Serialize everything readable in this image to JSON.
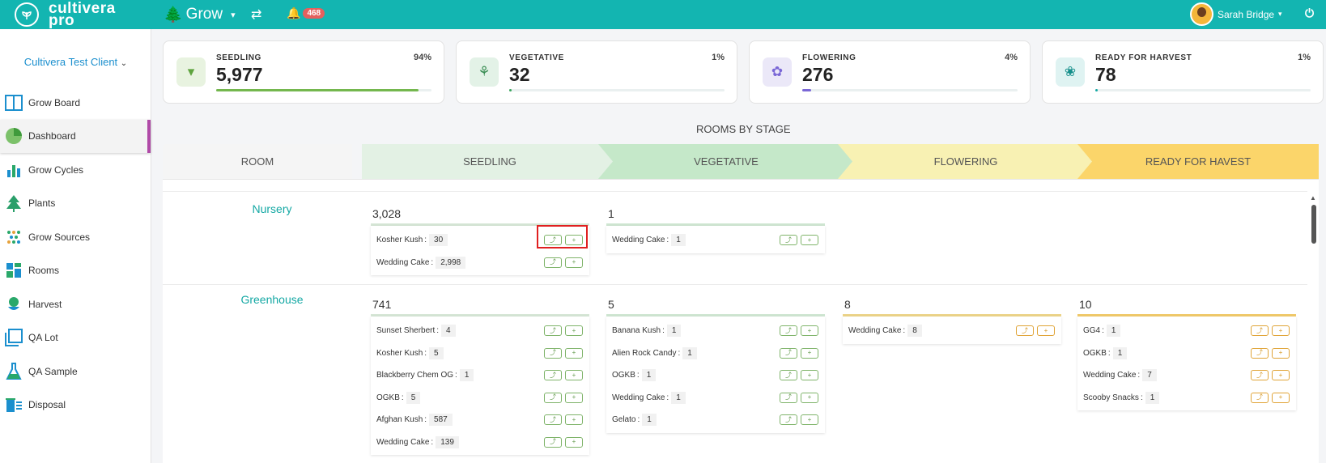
{
  "header": {
    "logo_text_1": "cultivera",
    "logo_text_2": "pro",
    "nav_grow": "Grow",
    "notifications": "468",
    "user_name": "Sarah Bridge"
  },
  "sidebar": {
    "client": "Cultivera Test Client",
    "items": [
      {
        "label": "Grow Board",
        "icon": "board-icon"
      },
      {
        "label": "Dashboard",
        "icon": "pie-chart-icon"
      },
      {
        "label": "Grow Cycles",
        "icon": "bar-chart-icon"
      },
      {
        "label": "Plants",
        "icon": "tree-icon"
      },
      {
        "label": "Grow Sources",
        "icon": "seeds-icon"
      },
      {
        "label": "Rooms",
        "icon": "rooms-icon"
      },
      {
        "label": "Harvest",
        "icon": "harvest-icon"
      },
      {
        "label": "QA Lot",
        "icon": "qa-lot-icon"
      },
      {
        "label": "QA Sample",
        "icon": "flask-icon"
      },
      {
        "label": "Disposal",
        "icon": "disposal-icon"
      }
    ]
  },
  "cards": [
    {
      "label": "SEEDLING",
      "value": "5,977",
      "pct": "94%",
      "fill": 0.94,
      "color": "#74b74e",
      "bg": "#e8f3e0",
      "icon_color": "#5ea43e"
    },
    {
      "label": "VEGETATIVE",
      "value": "32",
      "pct": "1%",
      "fill": 0.01,
      "color": "#3aa55d",
      "bg": "#e3f2e7",
      "icon_color": "#3a8d54"
    },
    {
      "label": "FLOWERING",
      "value": "276",
      "pct": "4%",
      "fill": 0.04,
      "color": "#7a67d6",
      "bg": "#ebe8f8",
      "icon_color": "#7a67d6"
    },
    {
      "label": "READY FOR HARVEST",
      "value": "78",
      "pct": "1%",
      "fill": 0.01,
      "color": "#17a9a4",
      "bg": "#dff3f2",
      "icon_color": "#148f8b"
    }
  ],
  "rooms_title": "ROOMS BY STAGE",
  "stages": {
    "room": "ROOM",
    "seedling": "SEEDLING",
    "vegetative": "VEGETATIVE",
    "flowering": "FLOWERING",
    "ready": "READY FOR HAVEST"
  },
  "rooms": [
    {
      "name": "Nursery",
      "seedling": {
        "total": "3,028",
        "strains": [
          {
            "name": "Kosher Kush",
            "count": "30"
          },
          {
            "name": "Wedding Cake",
            "count": "2,998"
          }
        ]
      },
      "vegetative": {
        "total": "1",
        "strains": [
          {
            "name": "Wedding Cake",
            "count": "1"
          }
        ]
      }
    },
    {
      "name": "Greenhouse",
      "seedling": {
        "total": "741",
        "strains": [
          {
            "name": "Sunset Sherbert",
            "count": "4"
          },
          {
            "name": "Kosher Kush",
            "count": "5"
          },
          {
            "name": "Blackberry Chem OG",
            "count": "1"
          },
          {
            "name": "OGKB",
            "count": "5"
          },
          {
            "name": "Afghan Kush",
            "count": "587"
          },
          {
            "name": "Wedding Cake",
            "count": "139"
          }
        ]
      },
      "vegetative": {
        "total": "5",
        "strains": [
          {
            "name": "Banana Kush",
            "count": "1"
          },
          {
            "name": "Alien Rock Candy",
            "count": "1"
          },
          {
            "name": "OGKB",
            "count": "1"
          },
          {
            "name": "Wedding Cake",
            "count": "1"
          },
          {
            "name": "Gelato",
            "count": "1"
          }
        ]
      },
      "flowering": {
        "total": "8",
        "strains": [
          {
            "name": "Wedding Cake",
            "count": "8"
          }
        ]
      },
      "ready": {
        "total": "10",
        "strains": [
          {
            "name": "GG4",
            "count": "1"
          },
          {
            "name": "OGKB",
            "count": "1"
          },
          {
            "name": "Wedding Cake",
            "count": "7"
          },
          {
            "name": "Scooby Snacks",
            "count": "1"
          }
        ]
      }
    }
  ],
  "strain_separator": ":",
  "button_glyphs": {
    "move": "⤴",
    "add": "+"
  }
}
